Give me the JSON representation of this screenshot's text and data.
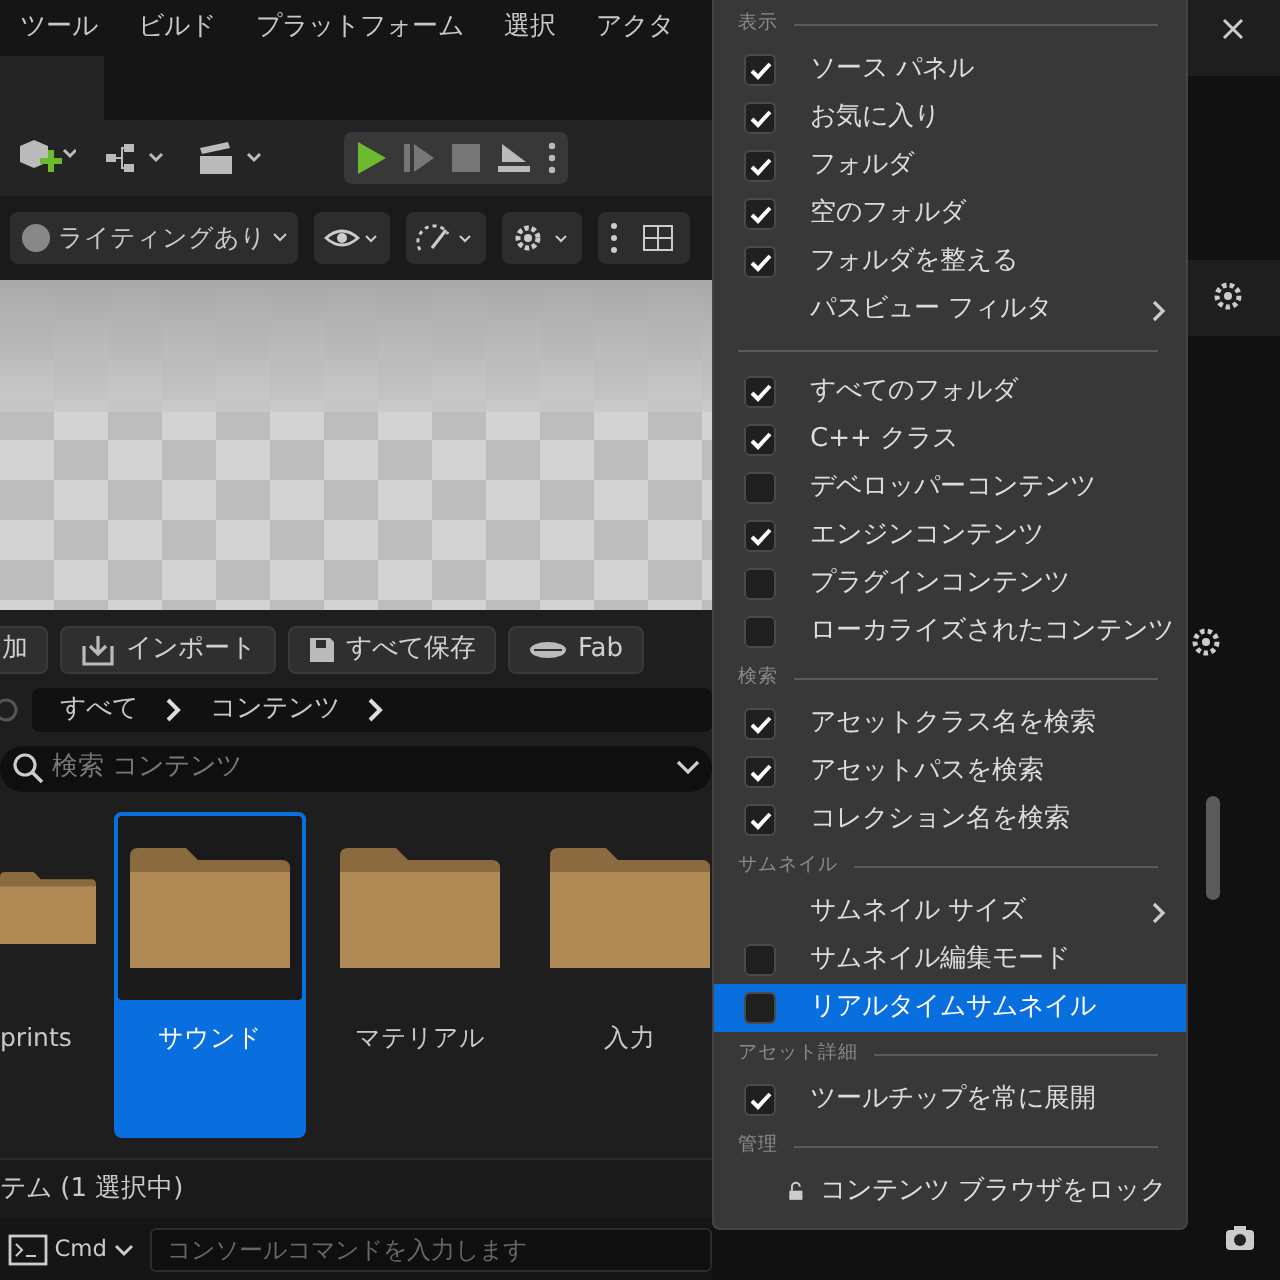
{
  "menubar": [
    "ツール",
    "ビルド",
    "プラットフォーム",
    "選択",
    "アクタ"
  ],
  "viewport_toolbar": {
    "lighting": "ライティングあり"
  },
  "content_toolbar": [
    "加",
    "インポート",
    "すべて保存",
    "Fab"
  ],
  "breadcrumb": [
    "すべて",
    "コンテンツ"
  ],
  "search": {
    "placeholder": "検索 コンテンツ"
  },
  "folders": [
    {
      "name": "prints",
      "selected": false
    },
    {
      "name": "サウンド",
      "selected": true
    },
    {
      "name": "マテリアル",
      "selected": false
    },
    {
      "name": "入力",
      "selected": false
    }
  ],
  "status": "テム (1 選択中)",
  "console": {
    "label": "Cmd",
    "placeholder": "コンソールコマンドを入力します"
  },
  "menu": [
    {
      "title": "表示",
      "items": [
        {
          "kind": "check",
          "label": "ソース パネル",
          "checked": true,
          "selected": false
        },
        {
          "kind": "check",
          "label": "お気に入り",
          "checked": true,
          "selected": false
        },
        {
          "kind": "check",
          "label": "フォルダ",
          "checked": true,
          "selected": false
        },
        {
          "kind": "check",
          "label": "空のフォルダ",
          "checked": true,
          "selected": false
        },
        {
          "kind": "check",
          "label": "フォルダを整える",
          "checked": true,
          "selected": false
        },
        {
          "kind": "submenu",
          "label": "パスビュー フィルタ",
          "selected": false
        }
      ]
    },
    {
      "items": [
        {
          "kind": "check",
          "label": "すべてのフォルダ",
          "checked": true,
          "selected": false
        },
        {
          "kind": "check",
          "label": "C++ クラス",
          "checked": true,
          "selected": false
        },
        {
          "kind": "check",
          "label": "デベロッパーコンテンツ",
          "checked": false,
          "selected": false
        },
        {
          "kind": "check",
          "label": "エンジンコンテンツ",
          "checked": true,
          "selected": false
        },
        {
          "kind": "check",
          "label": "プラグインコンテンツ",
          "checked": false,
          "selected": false
        },
        {
          "kind": "check",
          "label": "ローカライズされたコンテンツ",
          "checked": false,
          "selected": false
        }
      ]
    },
    {
      "title": "検索",
      "items": [
        {
          "kind": "check",
          "label": "アセットクラス名を検索",
          "checked": true,
          "selected": false
        },
        {
          "kind": "check",
          "label": "アセットパスを検索",
          "checked": true,
          "selected": false
        },
        {
          "kind": "check",
          "label": "コレクション名を検索",
          "checked": true,
          "selected": false
        }
      ]
    },
    {
      "title": "サムネイル",
      "items": [
        {
          "kind": "submenu",
          "label": "サムネイル サイズ",
          "selected": false
        },
        {
          "kind": "check",
          "label": "サムネイル編集モード",
          "checked": false,
          "selected": false
        },
        {
          "kind": "check",
          "label": "リアルタイムサムネイル",
          "checked": false,
          "selected": true
        }
      ]
    },
    {
      "title": "アセット詳細",
      "items": [
        {
          "kind": "check",
          "label": "ツールチップを常に展開",
          "checked": true,
          "selected": false
        }
      ]
    },
    {
      "title": "管理",
      "items": [
        {
          "kind": "lock",
          "label": "コンテンツ ブラウザをロック",
          "selected": false
        }
      ]
    }
  ]
}
